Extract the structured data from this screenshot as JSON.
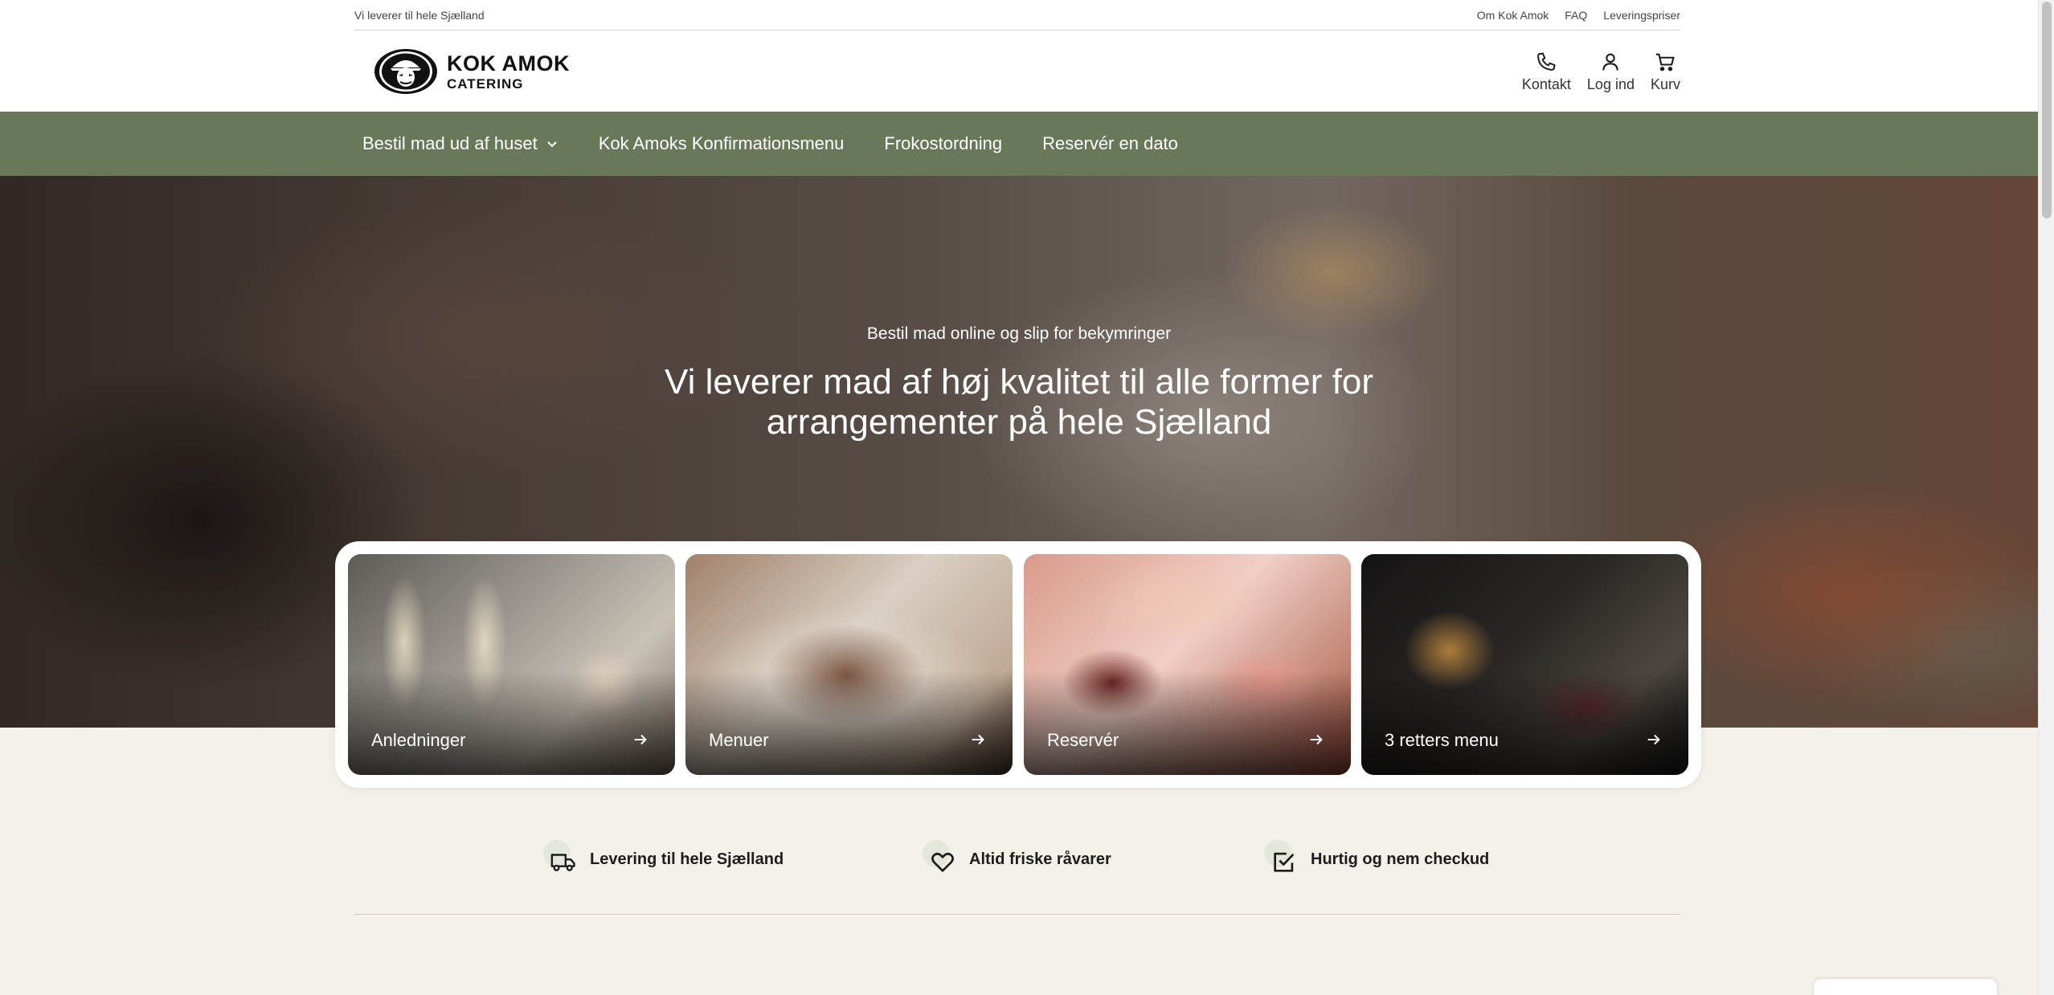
{
  "utility": {
    "tagline": "Vi leverer til hele Sjælland",
    "links": [
      "Om Kok Amok",
      "FAQ",
      "Leveringspriser"
    ]
  },
  "logo": {
    "line1": "KOK AMOK",
    "line2": "CATERING"
  },
  "header_actions": {
    "contact": "Kontakt",
    "login": "Log ind",
    "cart": "Kurv"
  },
  "nav": {
    "items": [
      "Bestil mad ud af huset",
      "Kok Amoks Konfirmationsmenu",
      "Frokostordning",
      "Reservér en dato"
    ]
  },
  "hero": {
    "subtitle": "Bestil mad online og slip for bekymringer",
    "title": "Vi leverer mad af høj kvalitet til alle former for arrangementer på hele Sjælland"
  },
  "cards": [
    "Anledninger",
    "Menuer",
    "Reservér",
    "3 retters menu"
  ],
  "features": [
    "Levering til hele Sjælland",
    "Altid friske råvarer",
    "Hurtig og nem checkud"
  ],
  "colors": {
    "nav_background": "#687859",
    "page_background": "#f4f1ea",
    "icon_blob": "#e4e8dc"
  }
}
